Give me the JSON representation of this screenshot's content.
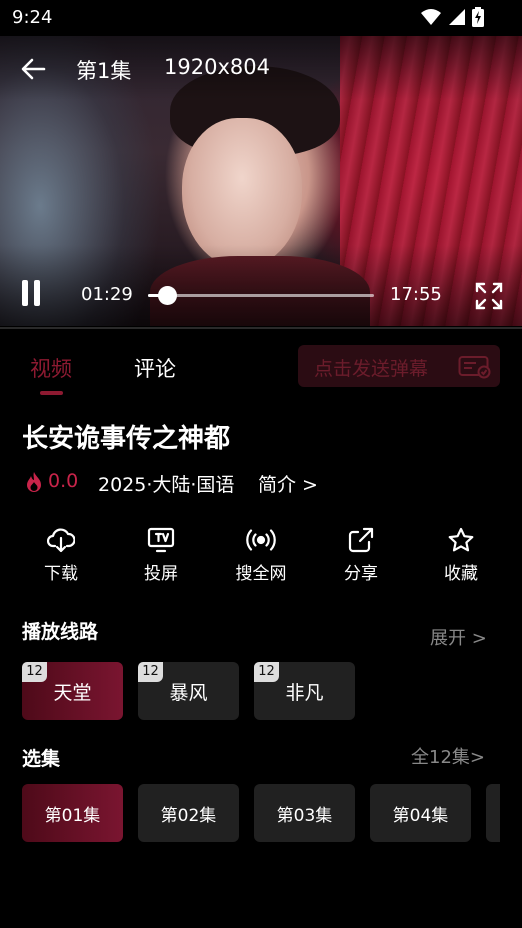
{
  "status_bar": {
    "time": "9:24",
    "icons": [
      "wifi-icon",
      "signal-icon",
      "battery-charging-icon"
    ]
  },
  "player": {
    "episode_title": "第1集",
    "resolution": "1920x804",
    "current_time": "01:29",
    "total_time": "17:55",
    "progress_fraction": 0.083,
    "state": "playing"
  },
  "tabs": {
    "video_label": "视频",
    "comments_label": "评论",
    "active": "video"
  },
  "danmaku": {
    "placeholder": "点击发送弹幕"
  },
  "show": {
    "title": "长安诡事传之神都",
    "rating": "0.0",
    "meta": "2025·大陆·国语",
    "intro_link": "简介 >"
  },
  "actions": [
    {
      "label": "下载",
      "icon": "download-icon"
    },
    {
      "label": "投屏",
      "icon": "cast-tv-icon"
    },
    {
      "label": "搜全网",
      "icon": "broadcast-icon"
    },
    {
      "label": "分享",
      "icon": "share-icon"
    },
    {
      "label": "收藏",
      "icon": "star-icon"
    }
  ],
  "lines_section": {
    "title": "播放线路",
    "expand_link": "展开 >",
    "items": [
      {
        "badge": "12",
        "label": "天堂",
        "active": true
      },
      {
        "badge": "12",
        "label": "暴风",
        "active": false
      },
      {
        "badge": "12",
        "label": "非凡",
        "active": false
      }
    ]
  },
  "episodes_section": {
    "title": "选集",
    "all_link": "全12集>",
    "items": [
      {
        "label": "第01集",
        "active": true
      },
      {
        "label": "第02集",
        "active": false
      },
      {
        "label": "第03集",
        "active": false
      },
      {
        "label": "第04集",
        "active": false
      }
    ]
  },
  "colors": {
    "accent": "#8d1a31",
    "rating": "#c8244a",
    "chip_bg": "#212121"
  }
}
